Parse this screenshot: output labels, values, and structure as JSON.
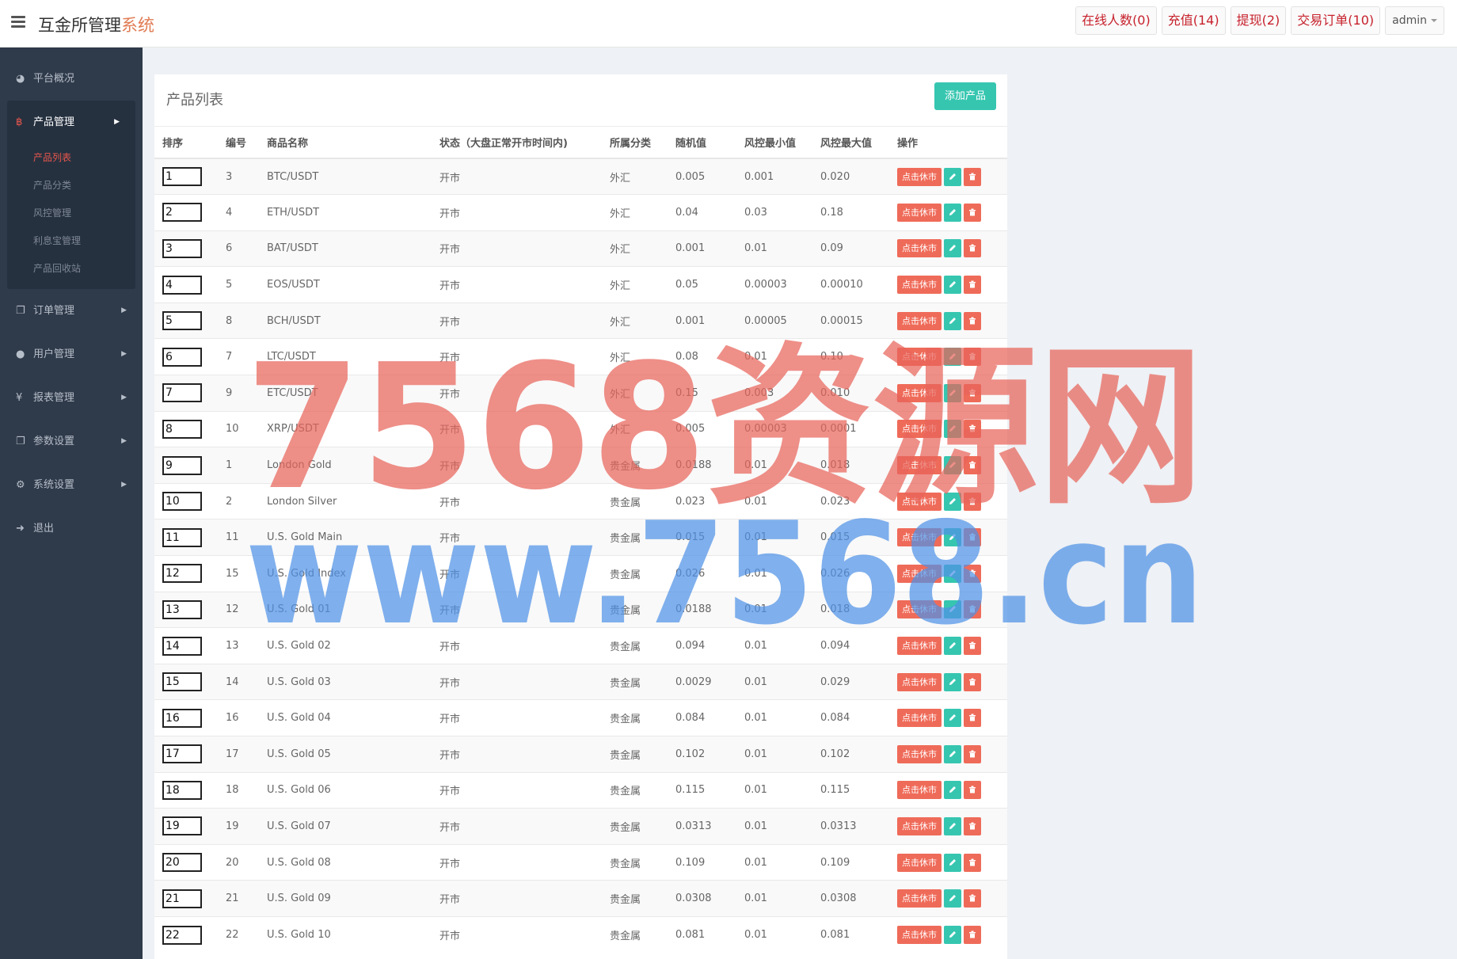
{
  "header": {
    "brand_main": "互金所管理",
    "brand_accent": "系统",
    "online_users": "在线人数(0)",
    "recharge": "充值(14)",
    "withdraw": "提现(2)",
    "trade_orders": "交易订单(10)",
    "user": "admin"
  },
  "sidebar": {
    "items": [
      {
        "label": "平台概况",
        "icon": "dashboard-icon"
      },
      {
        "label": "产品管理",
        "icon": "bitcoin-icon"
      },
      {
        "label": "订单管理",
        "icon": "copy-icon"
      },
      {
        "label": "用户管理",
        "icon": "user-icon"
      },
      {
        "label": "报表管理",
        "icon": "yen-icon"
      },
      {
        "label": "参数设置",
        "icon": "copy-icon"
      },
      {
        "label": "系统设置",
        "icon": "gears-icon"
      },
      {
        "label": "退出",
        "icon": "sign-out-icon"
      }
    ],
    "sub_items": [
      "产品列表",
      "产品分类",
      "风控管理",
      "利息宝管理",
      "产品回收站"
    ]
  },
  "panel": {
    "title": "产品列表",
    "add_button": "添加产品",
    "columns": [
      "排序",
      "编号",
      "商品名称",
      "状态（大盘正常开市时间内)",
      "所属分类",
      "随机值",
      "风控最小值",
      "风控最大值",
      "操作"
    ],
    "rest_label": "点击休市",
    "rows": [
      [
        "1",
        "3",
        "BTC/USDT",
        "开市",
        "外汇",
        "0.005",
        "0.001",
        "0.020"
      ],
      [
        "2",
        "4",
        "ETH/USDT",
        "开市",
        "外汇",
        "0.04",
        "0.03",
        "0.18"
      ],
      [
        "3",
        "6",
        "BAT/USDT",
        "开市",
        "外汇",
        "0.001",
        "0.01",
        "0.09"
      ],
      [
        "4",
        "5",
        "EOS/USDT",
        "开市",
        "外汇",
        "0.05",
        "0.00003",
        "0.00010"
      ],
      [
        "5",
        "8",
        "BCH/USDT",
        "开市",
        "外汇",
        "0.001",
        "0.00005",
        "0.00015"
      ],
      [
        "6",
        "7",
        "LTC/USDT",
        "开市",
        "外汇",
        "0.08",
        "0.01",
        "0.10"
      ],
      [
        "7",
        "9",
        "ETC/USDT",
        "开市",
        "外汇",
        "0.15",
        "0.003",
        "0.010"
      ],
      [
        "8",
        "10",
        "XRP/USDT",
        "开市",
        "外汇",
        "0.005",
        "0.00003",
        "0.0001"
      ],
      [
        "9",
        "1",
        "London Gold",
        "开市",
        "贵金属",
        "0.0188",
        "0.01",
        "0.018"
      ],
      [
        "10",
        "2",
        "London Silver",
        "开市",
        "贵金属",
        "0.023",
        "0.01",
        "0.023"
      ],
      [
        "11",
        "11",
        "U.S. Gold Main",
        "开市",
        "贵金属",
        "0.015",
        "0.01",
        "0.015"
      ],
      [
        "12",
        "15",
        "U.S. Gold Index",
        "开市",
        "贵金属",
        "0.026",
        "0.01",
        "0.026"
      ],
      [
        "13",
        "12",
        "U.S. Gold 01",
        "开市",
        "贵金属",
        "0.0188",
        "0.01",
        "0.018"
      ],
      [
        "14",
        "13",
        "U.S. Gold 02",
        "开市",
        "贵金属",
        "0.094",
        "0.01",
        "0.094"
      ],
      [
        "15",
        "14",
        "U.S. Gold 03",
        "开市",
        "贵金属",
        "0.0029",
        "0.01",
        "0.029"
      ],
      [
        "16",
        "16",
        "U.S. Gold 04",
        "开市",
        "贵金属",
        "0.084",
        "0.01",
        "0.084"
      ],
      [
        "17",
        "17",
        "U.S. Gold 05",
        "开市",
        "贵金属",
        "0.102",
        "0.01",
        "0.102"
      ],
      [
        "18",
        "18",
        "U.S. Gold 06",
        "开市",
        "贵金属",
        "0.115",
        "0.01",
        "0.115"
      ],
      [
        "19",
        "19",
        "U.S. Gold 07",
        "开市",
        "贵金属",
        "0.0313",
        "0.01",
        "0.0313"
      ],
      [
        "20",
        "20",
        "U.S. Gold 08",
        "开市",
        "贵金属",
        "0.109",
        "0.01",
        "0.109"
      ],
      [
        "21",
        "21",
        "U.S. Gold 09",
        "开市",
        "贵金属",
        "0.0308",
        "0.01",
        "0.0308"
      ],
      [
        "22",
        "22",
        "U.S. Gold 10",
        "开市",
        "贵金属",
        "0.081",
        "0.01",
        "0.081"
      ]
    ]
  },
  "watermark": {
    "line1": "7568资源网",
    "line2": "www.7568.cn"
  },
  "colors": {
    "accent_red": "#e7564b",
    "teal": "#36c6b0",
    "sidebar_bg": "#2f3a4a",
    "watermark_red": "#e8645a",
    "watermark_blue": "#4f92e6"
  }
}
